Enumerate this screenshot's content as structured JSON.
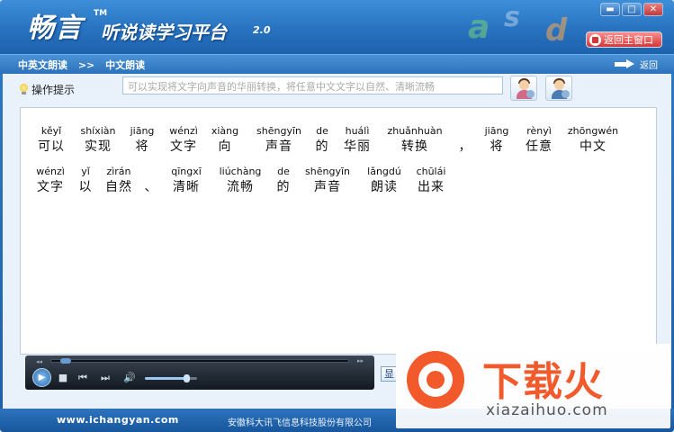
{
  "app": {
    "logo": "畅言",
    "trademark": "TM",
    "title": "听说读学习平台",
    "version": "2.0",
    "decor_letters": [
      "a",
      "s",
      "d"
    ],
    "window_buttons": {
      "minimize": "▬",
      "restore": "□",
      "close": "✕"
    },
    "return_main_label": "返回主窗口"
  },
  "breadcrumb": {
    "items": [
      "中英文朗读",
      ">>",
      "中文朗读"
    ],
    "back_label": "返回"
  },
  "toolbar": {
    "tip_label": "操作提示",
    "input_value": "可以实现将文字向声音的华丽转换，将任意中文文字以自然、清晰流畅"
  },
  "reading": {
    "lines": [
      [
        {
          "py": "kěyǐ",
          "hz": "可以"
        },
        {
          "py": "shíxiàn",
          "hz": "实现"
        },
        {
          "py": "jiāng",
          "hz": "将"
        },
        {
          "py": "wénzì",
          "hz": "文字"
        },
        {
          "py": "xiàng",
          "hz": "向"
        },
        {
          "py": "shēngyīn",
          "hz": "声音"
        },
        {
          "py": "de",
          "hz": "的"
        },
        {
          "py": "huálì",
          "hz": "华丽"
        },
        {
          "py": "zhuǎnhuàn",
          "hz": "转换"
        },
        {
          "py": "",
          "hz": "，"
        },
        {
          "py": "jiāng",
          "hz": "将"
        },
        {
          "py": "rènyì",
          "hz": "任意"
        },
        {
          "py": "zhōngwén",
          "hz": "中文"
        }
      ],
      [
        {
          "py": "wénzì",
          "hz": "文字"
        },
        {
          "py": "yǐ",
          "hz": "以"
        },
        {
          "py": "zìrán",
          "hz": "自然"
        },
        {
          "py": "",
          "hz": "、"
        },
        {
          "py": "qīngxī",
          "hz": "清晰"
        },
        {
          "py": "liúchàng",
          "hz": "流畅"
        },
        {
          "py": "de",
          "hz": "的"
        },
        {
          "py": "shēngyīn",
          "hz": "声音"
        },
        {
          "py": "lǎngdú",
          "hz": "朗读"
        },
        {
          "py": "chūlái",
          "hz": "出来"
        }
      ]
    ]
  },
  "player": {
    "progress": 0.03,
    "volume": 0.85,
    "play_icon": "play-icon",
    "seek_start_glyph": "◂◂",
    "seek_end_glyph": "▸▸",
    "stop_glyph": "■",
    "prev_glyph": "⏮",
    "next_glyph": "⏭",
    "volume_glyph": "🔊"
  },
  "side_options": {
    "show_label": "显"
  },
  "footer": {
    "url": "www.ichangyan.com",
    "company": "安徽科大讯飞信息科技股份有限公司"
  },
  "watermark": {
    "brand": "下载火",
    "domain": "xiazaihuo.com"
  },
  "colors": {
    "frame": "#2670bd",
    "return_button": "#d33636",
    "watermark": "#f25a2b"
  }
}
